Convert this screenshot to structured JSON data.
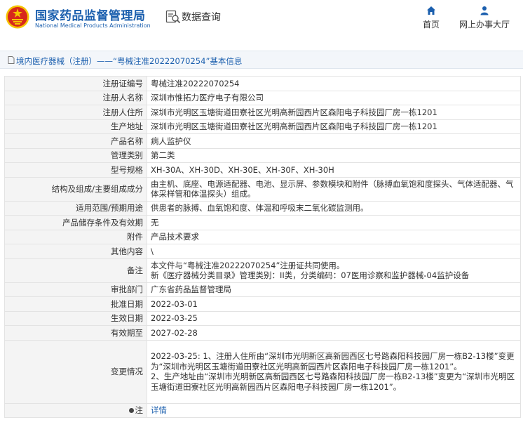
{
  "header": {
    "site_name_cn": "国家药品监督管理局",
    "site_name_en": "National Medical Products Administration",
    "query_title": "数据查询",
    "nav": [
      {
        "label": "首页",
        "icon": "home-icon"
      },
      {
        "label": "网上办事大厅",
        "icon": "user-icon"
      }
    ]
  },
  "colors": {
    "brand_blue": "#1b5fae",
    "emblem_red": "#d7281c",
    "emblem_gold": "#f5c400"
  },
  "section": {
    "title": "境内医疗器械（注册）——“粤械注准20222070254”基本信息"
  },
  "rows": [
    {
      "label": "注册证编号",
      "value": "粤械注准20222070254"
    },
    {
      "label": "注册人名称",
      "value": "深圳市惟拓力医疗电子有限公司"
    },
    {
      "label": "注册人住所",
      "value": "深圳市光明区玉塘街道田寮社区光明高新园西片区森阳电子科技园厂房一栋1201"
    },
    {
      "label": "生产地址",
      "value": "深圳市光明区玉塘街道田寮社区光明高新园西片区森阳电子科技园厂房一栋1201"
    },
    {
      "label": "产品名称",
      "value": "病人监护仪"
    },
    {
      "label": "管理类别",
      "value": "第二类"
    },
    {
      "label": "型号规格",
      "value": "XH-30A、XH-30D、XH-30E、XH-30F、XH-30H"
    },
    {
      "label": "结构及组成/主要组成成分",
      "value": "由主机、底座、电源适配器、电池、显示屏、参数模块和附件（脉搏血氧饱和度探头、气体适配器、气体采样管和体温探头）组成。"
    },
    {
      "label": "适用范围/预期用途",
      "value": "供患者的脉搏、血氧饱和度、体温和呼吸末二氧化碳监测用。"
    },
    {
      "label": "产品储存条件及有效期",
      "value": "无"
    },
    {
      "label": "附件",
      "value": "产品技术要求"
    },
    {
      "label": "其他内容",
      "value": "\\"
    },
    {
      "label": "备注",
      "value_lines": [
        "本文件与“粤械注准20222070254”注册证共同使用。",
        "新《医疗器械分类目录》管理类别：II类，分类编码：07医用诊察和监护器械-04监护设备"
      ]
    },
    {
      "label": "审批部门",
      "value": "广东省药品监督管理局"
    },
    {
      "label": "批准日期",
      "value": "2022-03-01"
    },
    {
      "label": "生效日期",
      "value": "2022-03-25"
    },
    {
      "label": "有效期至",
      "value": "2027-02-28"
    },
    {
      "label": "变更情况",
      "value_lines": [
        "2022-03-25: 1、注册人住所由“深圳市光明新区高新园西区七号路森阳科技园厂房一栋B2-13楼”变更为“深圳市光明区玉塘街道田寮社区光明高新园西片区森阳电子科技园厂房一栋1201”。",
        "2、生产地址由“深圳市光明新区高新园西区七号路森阳科技园厂房一栋B2-13楼”变更为“深圳市光明区玉塘街道田寮社区光明高新园西片区森阳电子科技园厂房一栋1201”。"
      ]
    },
    {
      "label": "注",
      "icon": "pin-icon",
      "link": "详情"
    }
  ]
}
